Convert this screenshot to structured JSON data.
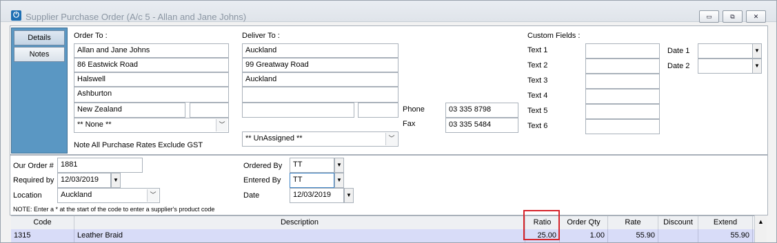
{
  "window": {
    "title": "Supplier Purchase Order (A/c 5 - Allan and Jane Johns)",
    "btn_minimize": "▭",
    "btn_restore": "⧉",
    "btn_close": "✕"
  },
  "nav": {
    "details": "Details",
    "notes": "Notes"
  },
  "order_to": {
    "label": "Order To  :",
    "line1": "Allan and Jane Johns",
    "line2": "86 Eastwick Road",
    "line3": "Halswell",
    "line4": "Ashburton",
    "country": "New Zealand",
    "postcode": "",
    "tax_combo": "** None **",
    "note": "Note All Purchase Rates Exclude GST"
  },
  "deliver_to": {
    "label": "Deliver To :",
    "line1": "Auckland",
    "line2": "99 Greatway Road",
    "line3": "Auckland",
    "line4": "",
    "line5": "",
    "line5b": "",
    "combo": "** UnAssigned **",
    "phone_label": "Phone",
    "phone": "03 335 8798",
    "fax_label": "Fax",
    "fax": "03 335 5484"
  },
  "custom": {
    "label": "Custom Fields  :",
    "text_labels": [
      "Text 1",
      "Text 2",
      "Text 3",
      "Text 4",
      "Text 5",
      "Text 6"
    ],
    "date1_label": "Date 1",
    "date2_label": "Date 2"
  },
  "order_info": {
    "our_order_label": "Our Order #",
    "our_order": "1881",
    "required_by_label": "Required by",
    "required_by": "12/03/2019",
    "location_label": "Location",
    "location": "Auckland",
    "ordered_by_label": "Ordered By",
    "ordered_by": "TT",
    "entered_by_label": "Entered By",
    "entered_by": "TT",
    "date_label": "Date",
    "date": "12/03/2019",
    "note": "NOTE: Enter a * at the start of the code to enter a supplier's product code"
  },
  "grid": {
    "headers": [
      "Code",
      "Description",
      "Ratio",
      "Order Qty",
      "Rate",
      "Discount",
      "Extend"
    ],
    "row": {
      "code": "1315",
      "description": "Leather Braid",
      "ratio": "25.00",
      "order_qty": "1.00",
      "rate": "55.90",
      "discount": "",
      "extend": "55.90"
    }
  },
  "colors": {
    "accent": "#5a97c3",
    "highlight": "#d6232a",
    "row_selected": "#d8dcf8"
  }
}
